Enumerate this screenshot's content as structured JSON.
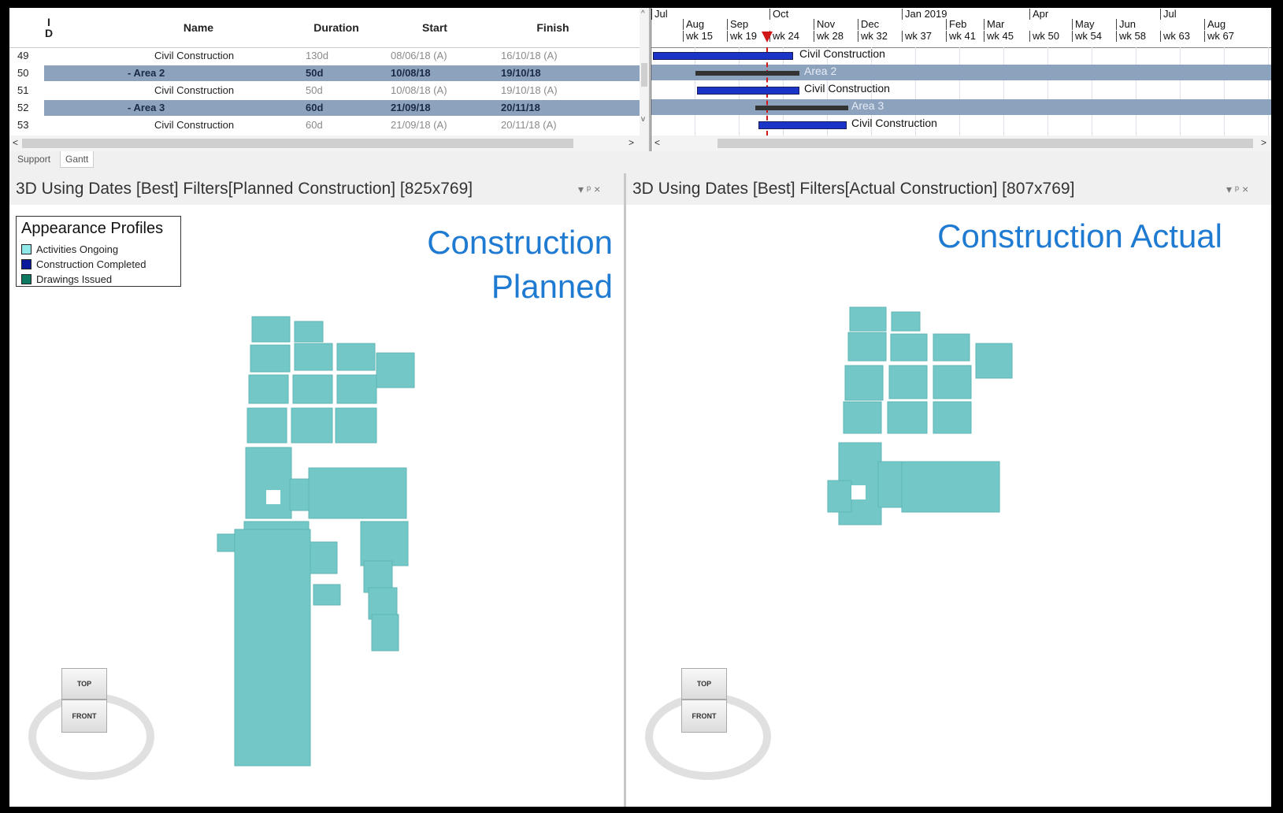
{
  "table": {
    "headers": {
      "id": "I\nD",
      "name": "Name",
      "duration": "Duration",
      "start": "Start",
      "finish": "Finish"
    },
    "rows": [
      {
        "id": "49",
        "name": "Civil Construction",
        "duration": "130d",
        "start": "08/06/18 (A)",
        "finish": "16/10/18 (A)",
        "summary": false
      },
      {
        "id": "50",
        "name": "- Area 2",
        "duration": "50d",
        "start": "10/08/18",
        "finish": "19/10/18",
        "summary": true
      },
      {
        "id": "51",
        "name": "Civil Construction",
        "duration": "50d",
        "start": "10/08/18 (A)",
        "finish": "19/10/18 (A)",
        "summary": false
      },
      {
        "id": "52",
        "name": "- Area 3",
        "duration": "60d",
        "start": "21/09/18",
        "finish": "20/11/18",
        "summary": true
      },
      {
        "id": "53",
        "name": "Civil Construction",
        "duration": "60d",
        "start": "21/09/18 (A)",
        "finish": "20/11/18 (A)",
        "summary": false
      }
    ]
  },
  "gantt": {
    "months": [
      "Jul",
      "Aug",
      "Sep",
      "Oct",
      "Nov",
      "Dec",
      "Jan 2019",
      "Feb",
      "Mar",
      "Apr",
      "May",
      "Jun",
      "Jul",
      "Aug"
    ],
    "weeks": [
      "wk 15",
      "wk 19",
      "wk 24",
      "wk 28",
      "wk 32",
      "wk 37",
      "wk 41",
      "wk 45",
      "wk 50",
      "wk 54",
      "wk 58",
      "wk 63",
      "wk 67"
    ],
    "bar_labels": [
      "Civil Construction",
      "Area 2",
      "Civil Construction",
      "Area 3",
      "Civil Construction"
    ]
  },
  "tabs": [
    "Support",
    "Gantt"
  ],
  "left_pane": {
    "title": "3D Using Dates [Best] Filters[Planned Construction] [825x769]",
    "heading_line1": "Construction",
    "heading_line2": "Planned",
    "controls": "▾ ᵖ ×"
  },
  "right_pane": {
    "title": "3D Using Dates [Best] Filters[Actual Construction] [807x769]",
    "heading_line1": "Construction Actual",
    "controls": "▾ ᵖ ×"
  },
  "legend": {
    "title": "Appearance Profiles",
    "items": [
      {
        "label": "Activities Ongoing",
        "color": "#8ee8e8"
      },
      {
        "label": "Construction Completed",
        "color": "#0a1a9a"
      },
      {
        "label": "Drawings Issued",
        "color": "#0f7a62"
      }
    ]
  },
  "navcube": {
    "top": "TOP",
    "front": "FRONT"
  },
  "colors": {
    "model": "#73c7c7",
    "summary_band": "#8da2bd",
    "bar": "#1b34c8",
    "heading": "#1f7ad1"
  }
}
